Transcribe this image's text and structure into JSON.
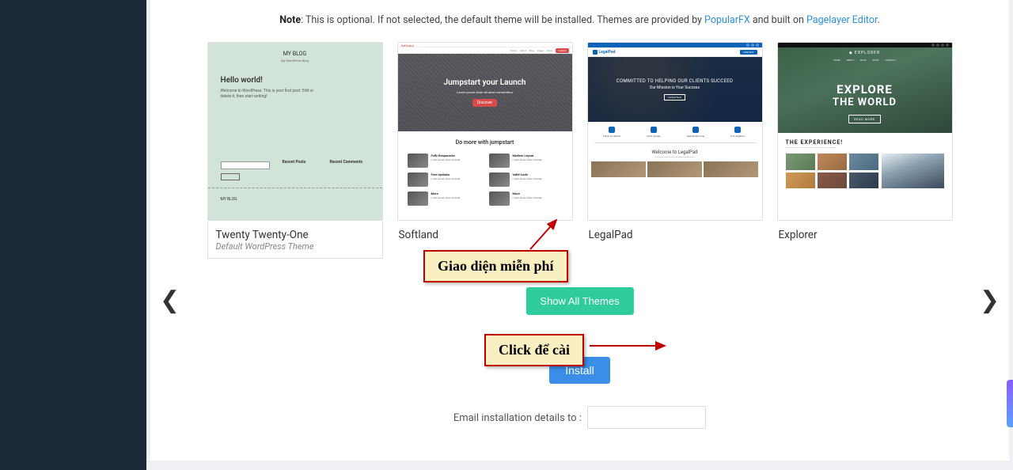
{
  "note": {
    "bold": "Note",
    "text1": ": This is optional. If not selected, the default theme will be installed. Themes are provided by ",
    "link1": "PopularFX",
    "text2": " and built on ",
    "link2": "Pagelayer Editor",
    "text3": "."
  },
  "themes": [
    {
      "name": "Twenty Twenty-One",
      "subtitle": "Default WordPress Theme"
    },
    {
      "name": "Softland",
      "subtitle": ""
    },
    {
      "name": "LegalPad",
      "subtitle": ""
    },
    {
      "name": "Explorer",
      "subtitle": ""
    }
  ],
  "thumb1": {
    "logo": "MY BLOG",
    "sub": "My WordPress Blog",
    "hello": "Hello world!",
    "para": "Welcome to WordPress. This is your first post. Edit or delete it, then start writing!",
    "recent": "Recent Posts",
    "recentC": "Recent Comments",
    "footer": "MY BLOG"
  },
  "thumb2": {
    "brand": "SoftLand",
    "heroTitle": "Jumpstart your Launch",
    "heroBtn": "Discover",
    "section": "Do more with jumpstart",
    "feat": [
      "Fully Responsive",
      "Modern Layout",
      "Free Updates",
      "Valid Code"
    ]
  },
  "thumb3": {
    "logo": "LegalPad",
    "contact": "CONTACT",
    "heroTitle": "COMMITTED TO HELPING OUR CLIENTS SUCCEED",
    "heroSub": "Our Mission is Your Success",
    "heroBtn": "Contact Now",
    "icons": [
      "Travel Accidents",
      "Work Injuries",
      "Real State Crime",
      "Civil Litigation"
    ],
    "welcome": "Welcome to LegalPad"
  },
  "thumb4": {
    "logo": "EXPLORER",
    "nav": [
      "HOME",
      "ABOUT",
      "BLOG",
      "SHOP",
      "CONTACT"
    ],
    "ht1": "EXPLORE",
    "ht2": "THE WORLD",
    "btn": "READ MORE",
    "section": "THE EXPERIENCE!"
  },
  "buttons": {
    "showAll": "Show All Themes",
    "install": "Install"
  },
  "annotations": {
    "freeTheme": "Giao diện miễn phí",
    "clickInstall": "Click để cài"
  },
  "email": {
    "label": "Email installation details to :",
    "value": ""
  }
}
